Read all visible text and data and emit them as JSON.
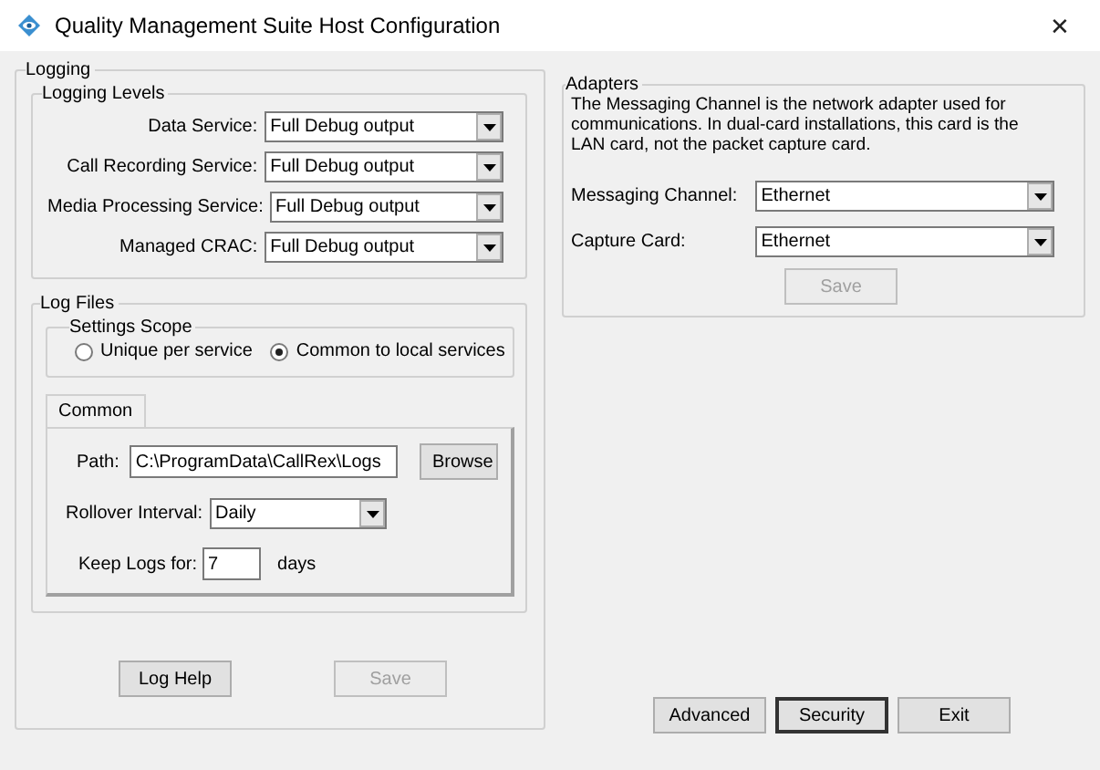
{
  "window": {
    "title": "Quality Management Suite Host Configuration",
    "close": "✕"
  },
  "logging": {
    "title": "Logging",
    "levels": {
      "title": "Logging Levels",
      "rows": [
        {
          "label": "Data Service:",
          "value": "Full Debug output"
        },
        {
          "label": "Call Recording Service:",
          "value": "Full Debug output"
        },
        {
          "label": "Media Processing Service:",
          "value": "Full Debug output"
        },
        {
          "label": "Managed CRAC:",
          "value": "Full Debug output"
        }
      ]
    },
    "log_files": {
      "title": "Log Files",
      "scope": {
        "title": "Settings Scope",
        "options": [
          {
            "label": "Unique per service",
            "selected": false
          },
          {
            "label": "Common to local services",
            "selected": true
          }
        ]
      },
      "tabs": [
        {
          "label": "Common",
          "selected": true
        }
      ],
      "path": {
        "label": "Path:",
        "value": "C:\\ProgramData\\CallRex\\Logs",
        "button": "Browse"
      },
      "rollover": {
        "label": "Rollover Interval:",
        "value": "Daily"
      },
      "keep": {
        "label": "Keep Logs for:",
        "value": "7",
        "unit": "days"
      }
    },
    "buttons": [
      {
        "label": "Log Help",
        "disabled": false
      },
      {
        "label": "Save",
        "disabled": true
      }
    ]
  },
  "adapters": {
    "title": "Adapters",
    "description": "The Messaging Channel is the network adapter used for communications.  In dual-card installations, this card is the LAN card, not the packet capture card.",
    "rows": [
      {
        "label": "Messaging Channel:",
        "value": "Ethernet"
      },
      {
        "label": "Capture Card:",
        "value": "Ethernet"
      }
    ],
    "save": {
      "label": "Save",
      "disabled": true
    }
  },
  "buttons": [
    {
      "label": "Advanced",
      "disabled": false,
      "focused": false
    },
    {
      "label": "Security",
      "disabled": false,
      "focused": true
    },
    {
      "label": "Exit",
      "disabled": false,
      "focused": false
    }
  ]
}
